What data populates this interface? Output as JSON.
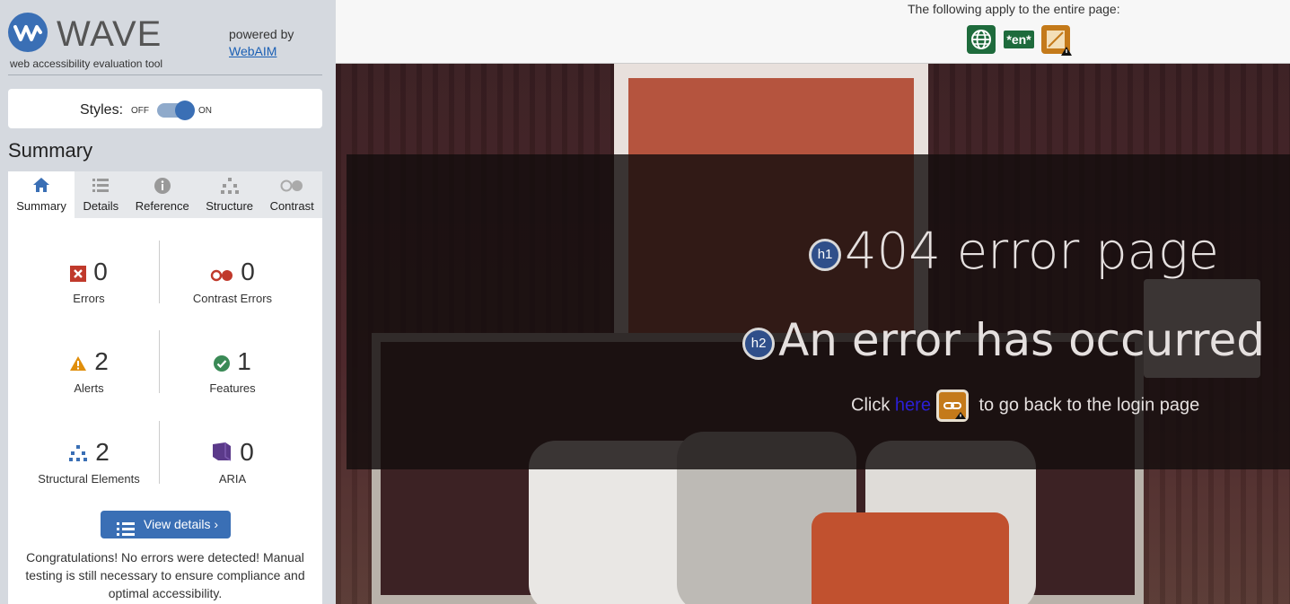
{
  "sidebar": {
    "logo_text": "WAVE",
    "logo_sub": "web accessibility evaluation tool",
    "powered_by": "powered by",
    "powered_link": "WebAIM",
    "styles_label": "Styles:",
    "toggle_off": "OFF",
    "toggle_on": "ON",
    "summary_title": "Summary",
    "tabs": [
      {
        "label": "Summary",
        "icon": "home-icon"
      },
      {
        "label": "Details",
        "icon": "list-icon"
      },
      {
        "label": "Reference",
        "icon": "info-icon"
      },
      {
        "label": "Structure",
        "icon": "structure-icon"
      },
      {
        "label": "Contrast",
        "icon": "contrast-icon"
      }
    ],
    "stats": {
      "errors": {
        "count": "0",
        "label": "Errors"
      },
      "contrast_errors": {
        "count": "0",
        "label": "Contrast Errors"
      },
      "alerts": {
        "count": "2",
        "label": "Alerts"
      },
      "features": {
        "count": "1",
        "label": "Features"
      },
      "structural": {
        "count": "2",
        "label": "Structural Elements"
      },
      "aria": {
        "count": "0",
        "label": "ARIA"
      }
    },
    "view_details": "View details ›",
    "congrats": "Congratulations! No errors were detected! Manual testing is still necessary to ensure compliance and optimal accessibility."
  },
  "topbar": {
    "apply_text": "The following apply to the entire page:",
    "lang_badge": "*en*"
  },
  "page": {
    "h1_badge": "h1",
    "h1": "404 error page",
    "h2_badge": "h2",
    "h2": "An error has occurred",
    "click_before": "Click",
    "click_link": "here",
    "click_after": "to go back to the login page"
  },
  "colors": {
    "accent": "#3a6fb5",
    "error": "#c0392b",
    "alert": "#e08e0b",
    "feature": "#3a8a56",
    "aria": "#5b3a8a"
  }
}
